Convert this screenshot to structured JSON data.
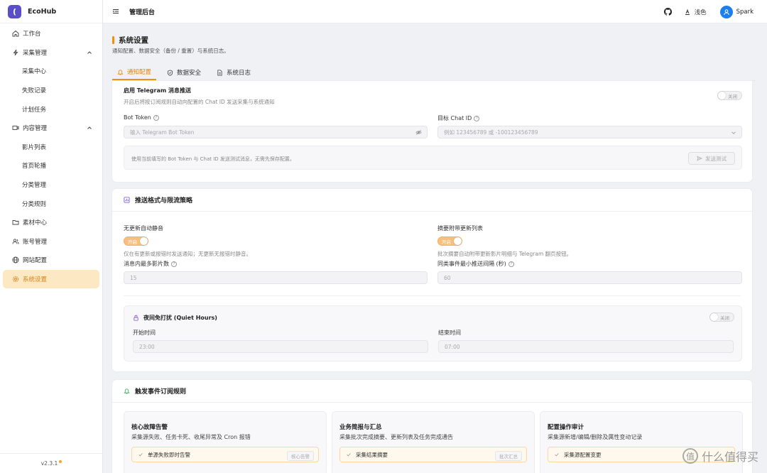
{
  "app": {
    "logo_glyph": "(",
    "name": "EcoHub",
    "version": "v2.3.1",
    "accent": "#f0900e",
    "brand": "#5b4fc9"
  },
  "sidebar": {
    "items": [
      {
        "label": "工作台",
        "icon": "home-icon"
      },
      {
        "label": "采集管理",
        "icon": "bolt-icon",
        "expanded": true
      },
      {
        "label": "采集中心"
      },
      {
        "label": "失败记录"
      },
      {
        "label": "计划任务"
      },
      {
        "label": "内容管理",
        "icon": "video-icon",
        "expanded": true
      },
      {
        "label": "影片列表"
      },
      {
        "label": "首页轮播"
      },
      {
        "label": "分类管理"
      },
      {
        "label": "分类规则"
      },
      {
        "label": "素材中心",
        "icon": "folder-icon"
      },
      {
        "label": "账号管理",
        "icon": "users-icon"
      },
      {
        "label": "网站配置",
        "icon": "globe-icon"
      },
      {
        "label": "系统设置",
        "icon": "gear-icon",
        "active": true
      }
    ]
  },
  "header": {
    "title": "管理后台",
    "theme_label": "浅色",
    "user_name": "Spark"
  },
  "page": {
    "title": "系统设置",
    "description": "通知配置、数据安全（备份 / 重置）与系统日志。",
    "tabs": [
      {
        "label": "通知配置",
        "active": true
      },
      {
        "label": "数据安全"
      },
      {
        "label": "系统日志"
      }
    ]
  },
  "telegram": {
    "enable_label": "启用 Telegram 消息推送",
    "enable_hint": "开启后将按订阅规则自动向配置的 Chat ID 发送采集与系统通知",
    "toggle_label": "关闭",
    "bot_token_label": "Bot Token",
    "bot_token_placeholder": "输入 Telegram Bot Token",
    "chat_id_label": "目标 Chat ID",
    "chat_id_placeholder": "例如 123456789 或 -100123456789",
    "test_hint": "使用当前填写的 Bot Token 与 Chat ID 发送测试消息，无需先保存配置。",
    "send_test_label": "发送测试"
  },
  "format": {
    "title": "推送格式与限流策略",
    "mute_label": "无更新自动静音",
    "mute_toggle": "开启",
    "mute_hint": "仅在有更新或报错时发送通知；无更新无报错时静音。",
    "attach_label": "摘要附带更新列表",
    "attach_toggle": "开启",
    "attach_hint": "批次摘要自动附带更新影片明细与 Telegram 翻页按钮。",
    "max_films_label": "消息内最多影片数",
    "max_films_value": "15",
    "min_interval_label": "同类事件最小推送间隔 (秒)",
    "min_interval_value": "60",
    "quiet_title": "夜间免打扰 (Quiet Hours)",
    "quiet_toggle": "关闭",
    "start_label": "开始时间",
    "start_value": "23:00",
    "end_label": "结束时间",
    "end_value": "07:00"
  },
  "rules": {
    "title": "触发事件订阅规则",
    "groups": [
      {
        "title": "核心故障告警",
        "desc": "采集源失败、任务卡死、收尾异常及 Cron 报错",
        "item": "单源失败即时告警",
        "tag": "核心告警"
      },
      {
        "title": "业务简报与汇总",
        "desc": "采集批次完成摘要、更新列表及任务完成通告",
        "item": "采集结果摘要",
        "tag": "批次汇总"
      },
      {
        "title": "配置操作审计",
        "desc": "采集源新增/编辑/删除及属性变动记录",
        "item": "采集源配置变更",
        "tag": ""
      }
    ]
  },
  "watermark": {
    "text": "什么值得买",
    "glyph": "值"
  }
}
